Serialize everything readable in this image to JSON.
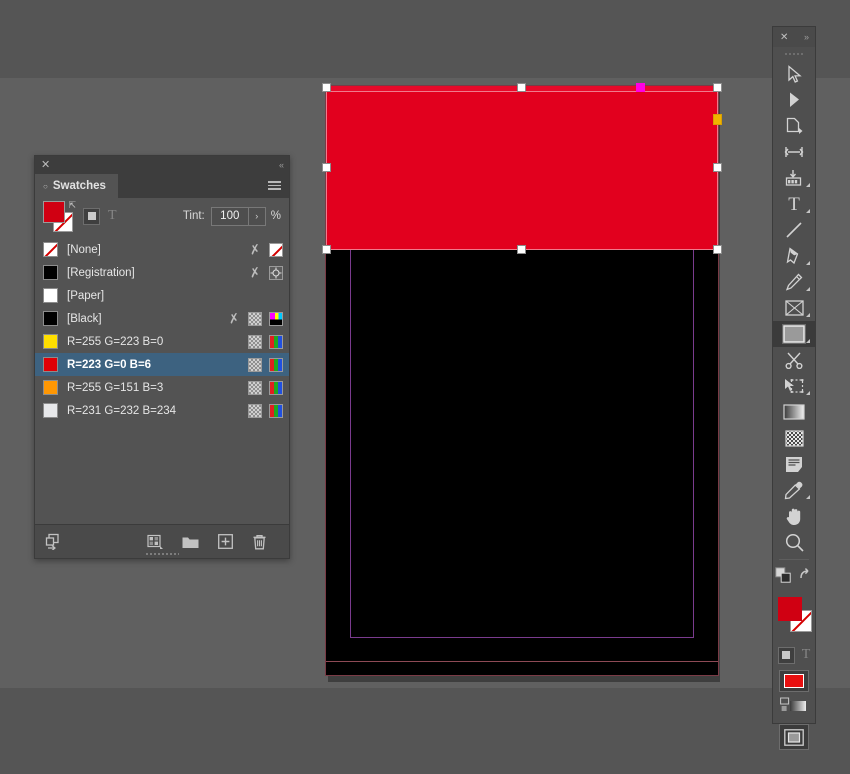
{
  "app": {
    "workspace_bg": "#606060",
    "chrome_bg": "#555555"
  },
  "document": {
    "page_bg": "#000000",
    "margin_guide_color": "#7a3b8e",
    "page_border_color": "#7a3b46",
    "object": {
      "name": "red-rectangle",
      "fill_color": "#e2001e",
      "selected": true,
      "handles": 8,
      "special_handle_color": "#ff00e4",
      "anchor_handle_color": "#f0b400"
    }
  },
  "panel": {
    "title": "Swatches",
    "close_label": "✕",
    "collapse_label": "«",
    "menu_name": "panel-menu-icon",
    "tint": {
      "label": "Tint:",
      "value": "100",
      "unit": "%",
      "stepper_label": "›"
    },
    "fill_color": "#d00012",
    "stroke_color": "none",
    "formatting": {
      "container_tooltip": "Formatting affects container",
      "text_tooltip": "Formatting affects text",
      "text_glyph": "T"
    },
    "swatches": [
      {
        "name": "[None]",
        "chip": "none",
        "chip_color": "#ffffff",
        "selected": false,
        "icons": [
          "lock",
          "none-box"
        ]
      },
      {
        "name": "[Registration]",
        "chip": "solid",
        "chip_color": "#000000",
        "selected": false,
        "icons": [
          "lock",
          "registration"
        ]
      },
      {
        "name": "[Paper]",
        "chip": "solid",
        "chip_color": "#ffffff",
        "selected": false,
        "icons": []
      },
      {
        "name": "[Black]",
        "chip": "solid",
        "chip_color": "#000000",
        "selected": false,
        "icons": [
          "lock",
          "tint",
          "cmyk"
        ]
      },
      {
        "name": "R=255 G=223 B=0",
        "chip": "solid",
        "chip_color": "#ffdf00",
        "selected": false,
        "icons": [
          "tint",
          "rgb"
        ]
      },
      {
        "name": "R=223 G=0 B=6",
        "chip": "solid",
        "chip_color": "#df0006",
        "selected": true,
        "icons": [
          "tint",
          "rgb"
        ]
      },
      {
        "name": "R=255 G=151 B=3",
        "chip": "solid",
        "chip_color": "#ff9703",
        "selected": false,
        "icons": [
          "tint",
          "rgb"
        ]
      },
      {
        "name": "R=231 G=232 B=234",
        "chip": "solid",
        "chip_color": "#e7e8ea",
        "selected": false,
        "icons": [
          "tint",
          "rgb"
        ]
      }
    ],
    "footer": {
      "library_label": "add-to-cc-library",
      "new_group_label": "new-color-group",
      "folder_label": "color-group-folder",
      "new_swatch_label": "new-swatch",
      "delete_label": "delete-swatch"
    },
    "selected_row_color": "#3d6280"
  },
  "toolbar": {
    "close_label": "✕",
    "expand_label": "»",
    "tools": [
      {
        "name": "selection-tool",
        "active": false,
        "has_flyout": false
      },
      {
        "name": "direct-selection-tool",
        "active": false,
        "has_flyout": false
      },
      {
        "name": "page-tool",
        "active": false,
        "has_flyout": false
      },
      {
        "name": "gap-tool",
        "active": false,
        "has_flyout": false
      },
      {
        "name": "content-collector-tool",
        "active": false,
        "has_flyout": true
      },
      {
        "name": "type-tool",
        "active": false,
        "has_flyout": true
      },
      {
        "name": "line-tool",
        "active": false,
        "has_flyout": false
      },
      {
        "name": "pen-tool",
        "active": false,
        "has_flyout": true
      },
      {
        "name": "pencil-tool",
        "active": false,
        "has_flyout": true
      },
      {
        "name": "rectangle-frame-tool",
        "active": false,
        "has_flyout": true
      },
      {
        "name": "rectangle-tool",
        "active": true,
        "has_flyout": true
      },
      {
        "name": "scissors-tool",
        "active": false,
        "has_flyout": false
      },
      {
        "name": "free-transform-tool",
        "active": false,
        "has_flyout": true
      },
      {
        "name": "gradient-swatch-tool",
        "active": false,
        "has_flyout": false
      },
      {
        "name": "gradient-feather-tool",
        "active": false,
        "has_flyout": false
      },
      {
        "name": "note-tool",
        "active": false,
        "has_flyout": false
      },
      {
        "name": "eyedropper-tool",
        "active": false,
        "has_flyout": true
      },
      {
        "name": "hand-tool",
        "active": false,
        "has_flyout": false
      },
      {
        "name": "zoom-tool",
        "active": false,
        "has_flyout": false
      }
    ],
    "fill_color": "#d00012",
    "stroke_color": "none",
    "apply_color_swatch": "#e81010",
    "formatting_text_glyph": "T",
    "screen_mode_label": "screen-mode"
  }
}
